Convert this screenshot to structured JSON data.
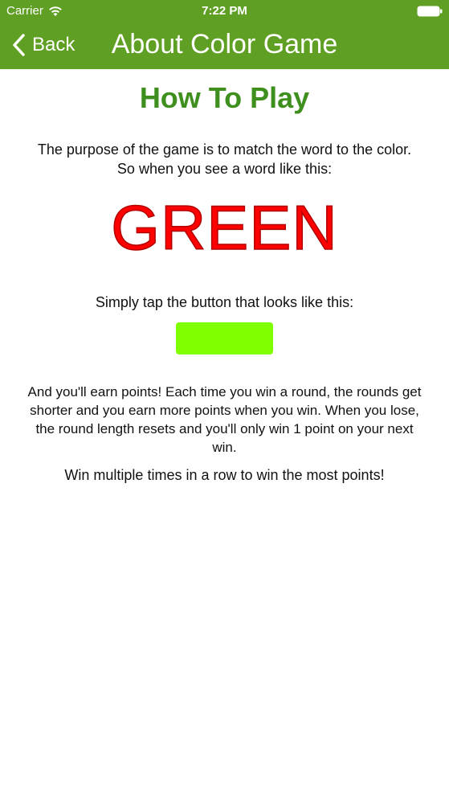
{
  "status_bar": {
    "carrier": "Carrier",
    "time": "7:22 PM",
    "wifi_icon": "wifi-icon",
    "battery_icon": "battery-icon"
  },
  "nav": {
    "back_label": "Back",
    "title": "About Color Game",
    "bar_color": "#5f9f23"
  },
  "content": {
    "heading": "How To Play",
    "intro": "The purpose of the game is to match the word to the color. So when you see a word like this:",
    "example_word": "GREEN",
    "example_word_color": "#ff0000",
    "tap_instruction": "Simply tap the button that looks like this:",
    "example_button_color": "#7fff00",
    "scoring": "And you'll earn points! Each time you win a round, the rounds get shorter and you earn more points when you win. When you lose, the round length resets and you'll only win 1 point on your next win.",
    "tip": "Win multiple times in a row to win the most points!"
  }
}
